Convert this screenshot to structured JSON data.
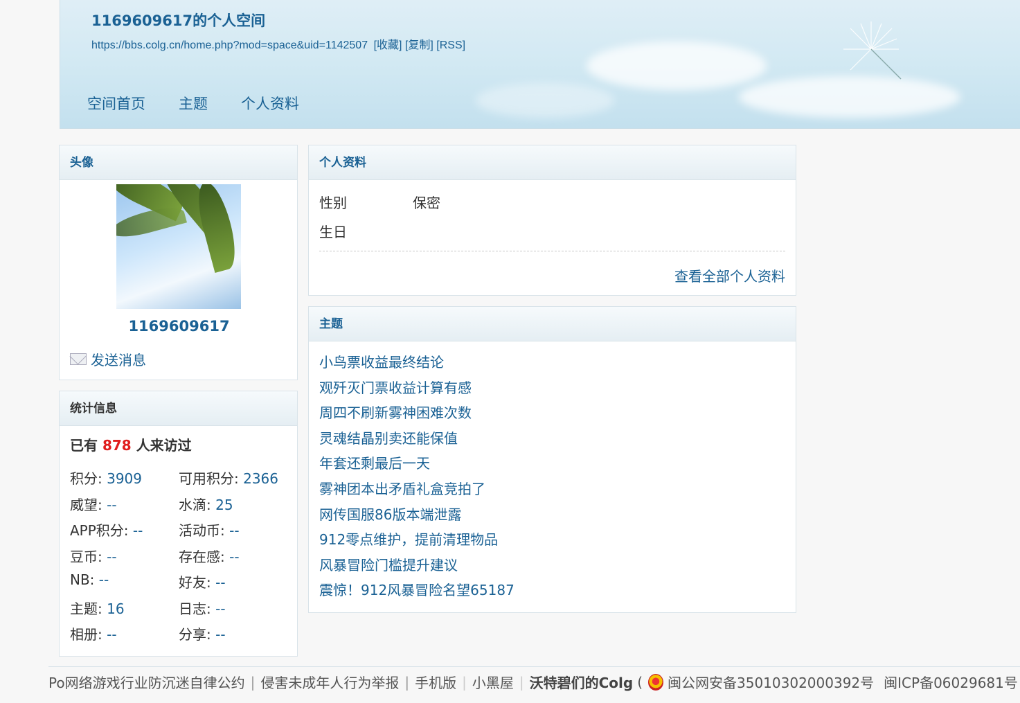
{
  "header": {
    "title": "1169609617的个人空间",
    "url": "https://bbs.colg.cn/home.php?mod=space&uid=1142507",
    "url_actions": [
      "[收藏]",
      "[复制]",
      "[RSS]"
    ],
    "nav": [
      "空间首页",
      "主题",
      "个人资料"
    ]
  },
  "avatar_panel": {
    "heading": "头像",
    "username": "1169609617",
    "send_message": "发送消息"
  },
  "stats_panel": {
    "heading": "统计信息",
    "visits_prefix": "已有",
    "visits_count": "878",
    "visits_suffix": "人来访过",
    "items": [
      {
        "label": "积分:",
        "value": "3909"
      },
      {
        "label": "可用积分:",
        "value": "2366"
      },
      {
        "label": "威望:",
        "value": "--"
      },
      {
        "label": "水滴:",
        "value": "25"
      },
      {
        "label": "APP积分:",
        "value": "--"
      },
      {
        "label": "活动币:",
        "value": "--"
      },
      {
        "label": "豆币:",
        "value": "--"
      },
      {
        "label": "存在感:",
        "value": "--"
      },
      {
        "label": "NB:",
        "value": "--"
      },
      {
        "label": "好友:",
        "value": "--"
      },
      {
        "label": "主题:",
        "value": "16"
      },
      {
        "label": "日志:",
        "value": "--"
      },
      {
        "label": "相册:",
        "value": "--"
      },
      {
        "label": "分享:",
        "value": "--"
      }
    ]
  },
  "profile_panel": {
    "heading": "个人资料",
    "gender_label": "性别",
    "gender_value": "保密",
    "birthday_label": "生日",
    "birthday_value": "",
    "view_all": "查看全部个人资料"
  },
  "topics_panel": {
    "heading": "主题",
    "topics": [
      "小鸟票收益最终结论",
      "观歼灭门票收益计算有感",
      "周四不刷新雾神困难次数",
      "灵魂结晶别卖还能保值",
      "年套还剩最后一天",
      "雾神团本出矛盾礼盒竞拍了",
      "网传国服86版本端泄露",
      "912零点维护，提前清理物品",
      "风暴冒险门槛提升建议",
      "震惊！912风暴冒险名望65187"
    ]
  },
  "footer": {
    "links": [
      "Po网络游戏行业防沉迷自律公约",
      "侵害未成年人行为举报",
      "手机版",
      "小黑屋"
    ],
    "site_name": "沃特碧们的Colg",
    "paren_open": "(",
    "police_record": "闽公网安备35010302000392号",
    "icp_record": "闽ICP备06029681号"
  },
  "colors": {
    "link": "#1a6194",
    "highlight": "#e01d1d",
    "header_bg": "#d2e9f3"
  }
}
